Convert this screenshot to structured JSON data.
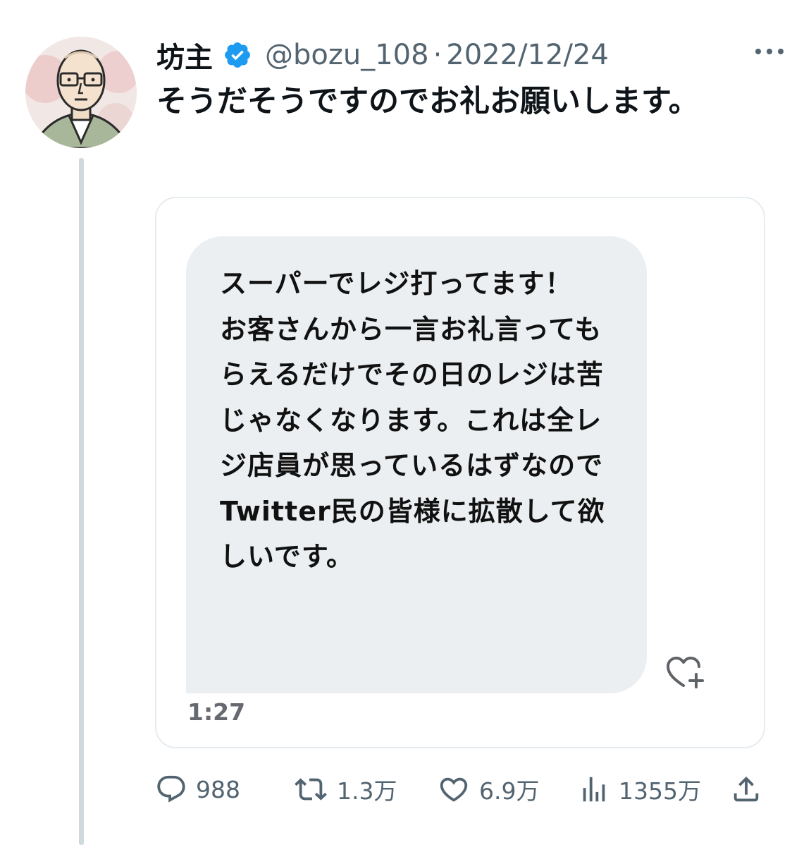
{
  "tweet": {
    "author": {
      "display_name": "坊主",
      "handle": "@bozu_108",
      "verified": true,
      "avatar_icon": "cartoon-monk-avatar"
    },
    "separator": "·",
    "date": "2022/12/24",
    "text": "そうだそうですのでお礼お願いします。"
  },
  "quote": {
    "message": "スーパーでレジ打ってます！\nお客さんから一言お礼言ってもらえるだけでその日のレジは苦じゃなくなります。これは全レジ店員が思っているはずなので\nTwitter民の皆様に拡散して欲しいです。",
    "time": "1:27",
    "react_icon": "heart-plus-icon"
  },
  "actions": {
    "reply": {
      "icon": "reply-icon",
      "count": "988"
    },
    "retweet": {
      "icon": "retweet-icon",
      "count": "1.3万"
    },
    "like": {
      "icon": "heart-icon",
      "count": "6.9万"
    },
    "views": {
      "icon": "views-chart-icon",
      "count": "1355万"
    },
    "share": {
      "icon": "share-icon"
    }
  },
  "colors": {
    "text_primary": "#0f1419",
    "text_secondary": "#536471",
    "verified_blue": "#1d9bf0",
    "bubble_bg": "#eceff1",
    "thread_line": "#cfd9de"
  }
}
